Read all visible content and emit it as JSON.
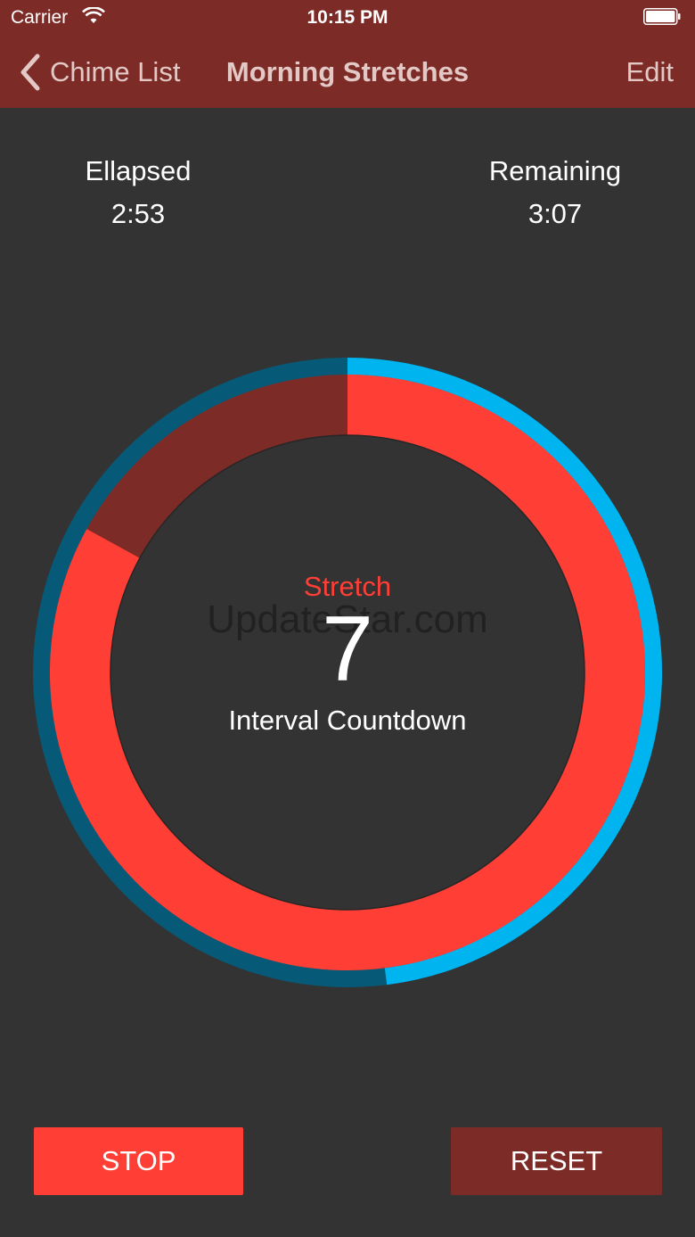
{
  "status_bar": {
    "carrier": "Carrier",
    "time": "10:15 PM"
  },
  "nav": {
    "back_label": "Chime List",
    "title": "Morning Stretches",
    "edit_label": "Edit"
  },
  "stats": {
    "elapsed_label": "Ellapsed",
    "elapsed_value": "2:53",
    "remaining_label": "Remaining",
    "remaining_value": "3:07"
  },
  "timer": {
    "interval_name": "Stretch",
    "countdown": "7",
    "countdown_label": "Interval Countdown",
    "total_progress_fraction": 0.48,
    "interval_progress_fraction": 0.83
  },
  "watermark": "UpdateStar.com",
  "buttons": {
    "stop_label": "STOP",
    "reset_label": "RESET"
  },
  "colors": {
    "header_bg": "#7d2b27",
    "background": "#333333",
    "accent_red": "#ff3f36",
    "accent_dark_red": "#7d2b27",
    "ring_blue_light": "#00b4f0",
    "ring_blue_dark": "#065a78"
  },
  "icons": {
    "back": "chevron-left-icon",
    "wifi": "wifi-icon",
    "battery": "battery-icon"
  }
}
